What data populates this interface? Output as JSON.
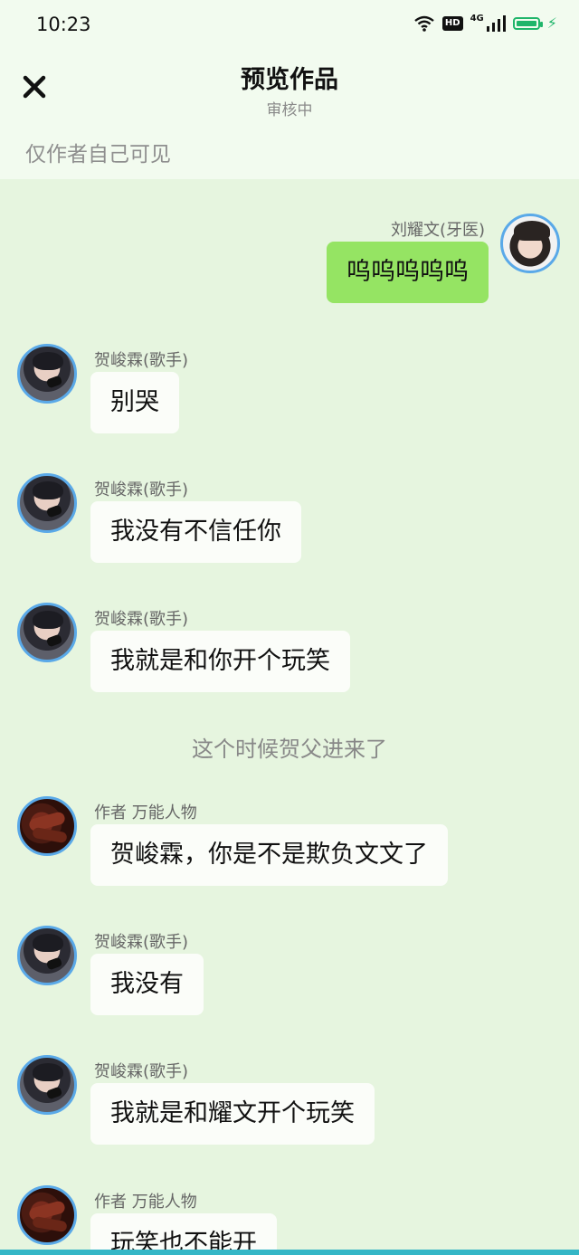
{
  "status_bar": {
    "time": "10:23",
    "hd_label": "HD",
    "network_label": "4G",
    "icons": [
      "wifi-icon",
      "hd-icon",
      "signal-icon",
      "battery-icon",
      "charging-icon"
    ]
  },
  "header": {
    "close_icon": "close-icon",
    "title": "预览作品",
    "subtitle": "审核中",
    "visibility_note": "仅作者自己可见"
  },
  "messages": [
    {
      "name": "刘耀文(牙医)",
      "text": "呜呜呜呜呜"
    },
    {
      "name": "贺峻霖(歌手)",
      "text": "别哭"
    },
    {
      "name": "贺峻霖(歌手)",
      "text": "我没有不信任你"
    },
    {
      "name": "贺峻霖(歌手)",
      "text": "我就是和你开个玩笑"
    },
    {
      "narration": "这个时候贺父进来了"
    },
    {
      "name": "作者 万能人物",
      "text": "贺峻霖，你是不是欺负文文了"
    },
    {
      "name": "贺峻霖(歌手)",
      "text": "我没有"
    },
    {
      "name": "贺峻霖(歌手)",
      "text": "我就是和耀文开个玩笑"
    },
    {
      "name": "作者 万能人物",
      "text": "玩笑也不能开"
    }
  ],
  "colors": {
    "chat_background": "#e6f5df",
    "header_background": "#f2fbef",
    "right_bubble": "#95e463",
    "left_bubble": "#fbfdf9",
    "avatar_ring": "#5aa9e8",
    "battery": "#1fb56a"
  }
}
